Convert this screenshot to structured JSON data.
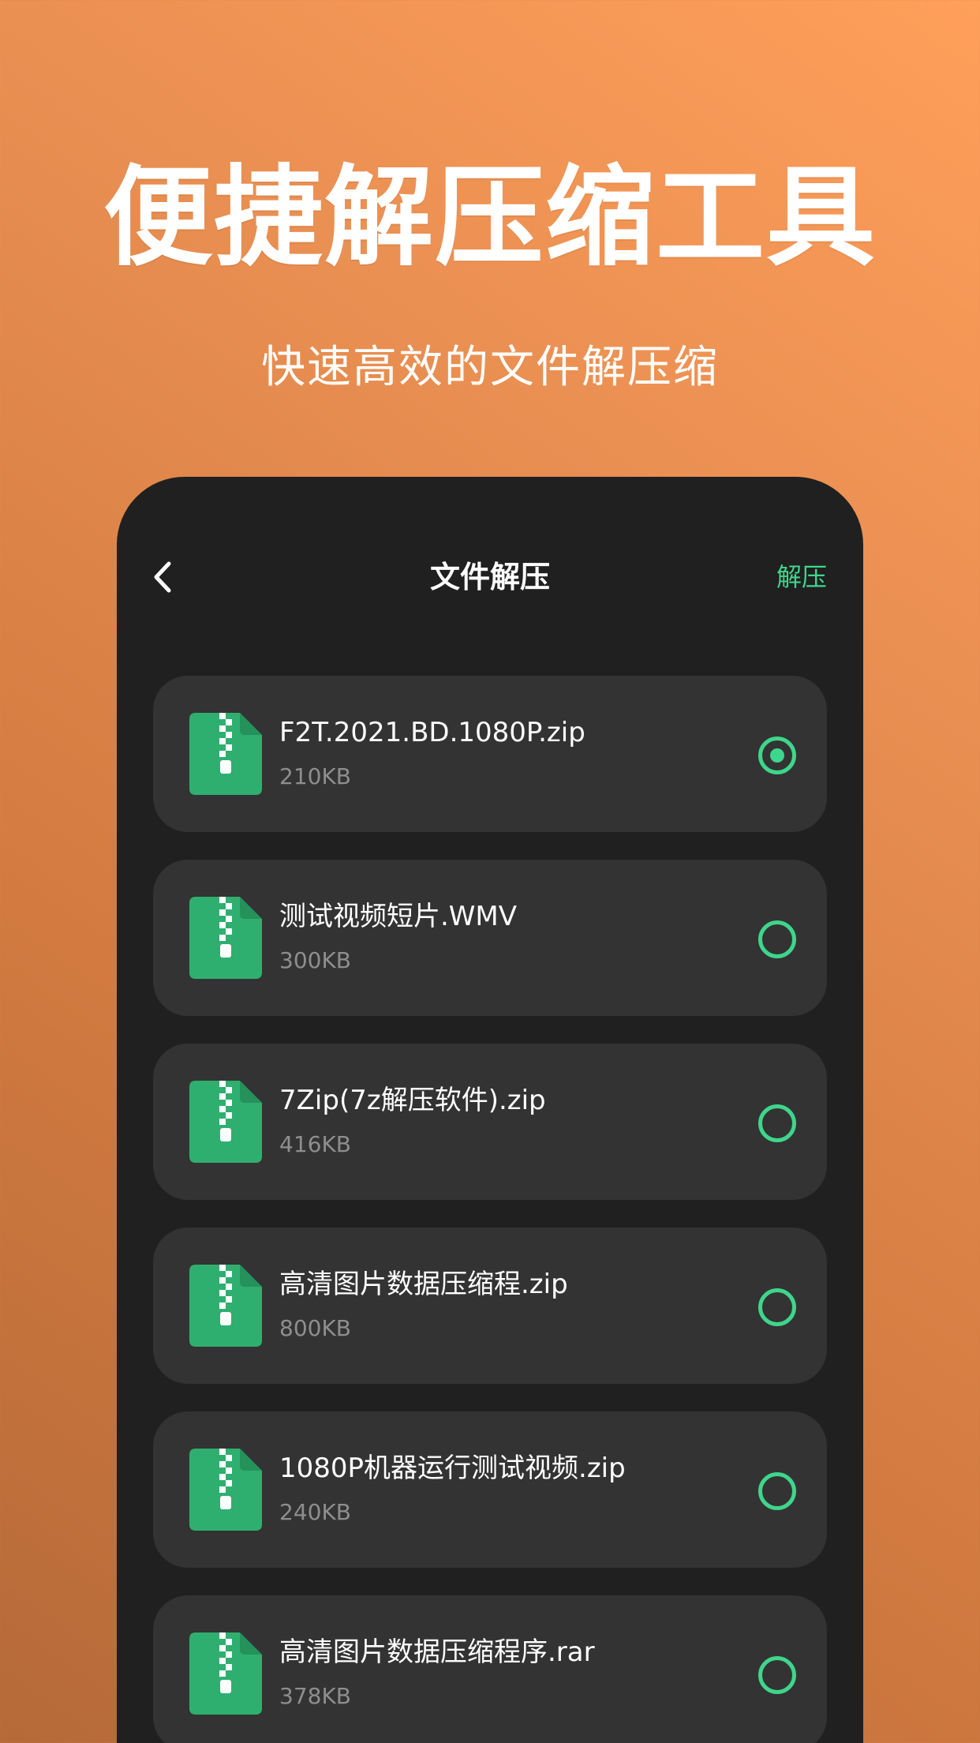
{
  "promo": {
    "headline": "便捷解压缩工具",
    "subheadline": "快速高效的文件解压缩"
  },
  "nav": {
    "back_icon": "chevron-left-icon",
    "title": "文件解压",
    "action_label": "解压"
  },
  "colors": {
    "accent": "#3ed68c",
    "zip_icon": "#2faf6f",
    "panel": "#202020",
    "card": "#333333"
  },
  "files": [
    {
      "name": "F2T.2021.BD.1080P.zip",
      "size": "210KB",
      "selected": true
    },
    {
      "name": "测试视频短片.WMV",
      "size": "300KB",
      "selected": false
    },
    {
      "name": "7Zip(7z解压软件).zip",
      "size": "416KB",
      "selected": false
    },
    {
      "name": "高清图片数据压缩程.zip",
      "size": "800KB",
      "selected": false
    },
    {
      "name": "1080P机器运行测试视频.zip",
      "size": "240KB",
      "selected": false
    },
    {
      "name": "高清图片数据压缩程序.rar",
      "size": "378KB",
      "selected": false
    }
  ]
}
